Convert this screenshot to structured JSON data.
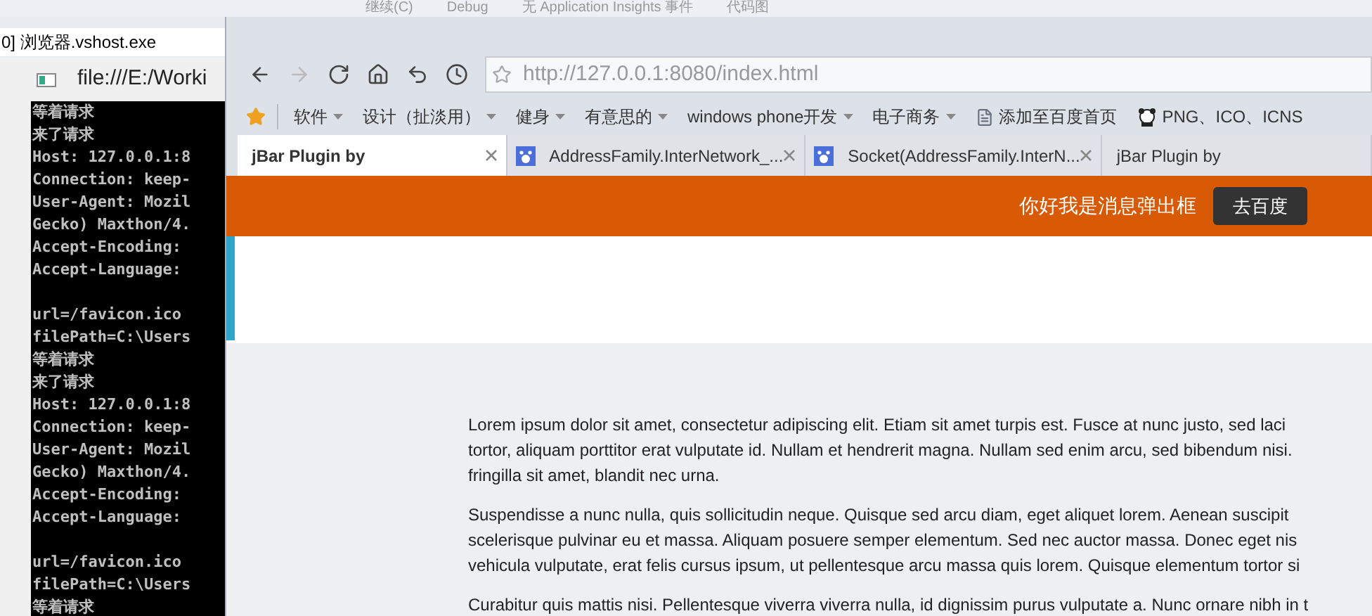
{
  "ide_toolbar": {
    "items": [
      "继续(C)",
      "Debug",
      "无 Application Insights 事件",
      "代码图"
    ]
  },
  "console": {
    "caption": "0] 浏览器.vshost.exe",
    "title": "file:///E:/Worki",
    "blocks": [
      [
        "等着请求",
        "来了请求",
        "Host: 127.0.0.1:8",
        "Connection: keep-",
        "User-Agent: Mozil",
        "Gecko) Maxthon/4.",
        "Accept-Encoding:",
        "Accept-Language:"
      ],
      [
        "url=/favicon.ico",
        "filePath=C:\\Users",
        "等着请求",
        "来了请求",
        "Host: 127.0.0.1:8",
        "Connection: keep-",
        "User-Agent: Mozil",
        "Gecko) Maxthon/4.",
        "Accept-Encoding:",
        "Accept-Language:"
      ],
      [
        "url=/favicon.ico",
        "filePath=C:\\Users",
        "等着请求"
      ]
    ]
  },
  "browser": {
    "address": "http://127.0.0.1:8080/index.html",
    "bookmarks": [
      {
        "kind": "folder",
        "label": "软件"
      },
      {
        "kind": "folder",
        "label": "设计（扯淡用）"
      },
      {
        "kind": "folder",
        "label": "健身"
      },
      {
        "kind": "folder",
        "label": "有意思的"
      },
      {
        "kind": "folder",
        "label": "windows phone开发"
      },
      {
        "kind": "folder",
        "label": "电子商务"
      },
      {
        "kind": "page",
        "label": "添加至百度首页"
      },
      {
        "kind": "image",
        "label": "PNG、ICO、ICNS"
      }
    ],
    "tabs": [
      {
        "label": "jBar Plugin by",
        "selected": true,
        "icon": false,
        "closable": true
      },
      {
        "label": "AddressFamily.InterNetwork_...",
        "selected": false,
        "icon": true,
        "closable": true
      },
      {
        "label": "Socket(AddressFamily.InterN...",
        "selected": false,
        "icon": true,
        "closable": true
      },
      {
        "label": "jBar Plugin by",
        "selected": false,
        "icon": false,
        "closable": false
      }
    ],
    "message_bar": {
      "message": "你好我是消息弹出框",
      "button": "去百度"
    },
    "paragraphs": [
      [
        "Lorem ipsum dolor sit amet, consectetur adipiscing elit. Etiam sit amet turpis est. Fusce at nunc justo, sed laci",
        "tortor, aliquam porttitor erat vulputate id. Nullam et hendrerit magna. Nullam sed enim arcu, sed bibendum nisi.",
        "fringilla sit amet, blandit nec urna."
      ],
      [
        "Suspendisse a nunc nulla, quis sollicitudin neque. Quisque sed arcu diam, eget aliquet lorem. Aenean suscipit",
        "scelerisque pulvinar eu et massa. Aliquam posuere semper elementum. Sed nec auctor massa. Donec eget nis",
        "vehicula vulputate, erat felis cursus ipsum, ut pellentesque arcu massa quis lorem. Quisque elementum tortor si"
      ],
      [
        "Curabitur quis mattis nisi. Pellentesque viverra viverra nulla, id dignissim purus vulputate a. Nunc ornare nibh in t"
      ]
    ]
  }
}
